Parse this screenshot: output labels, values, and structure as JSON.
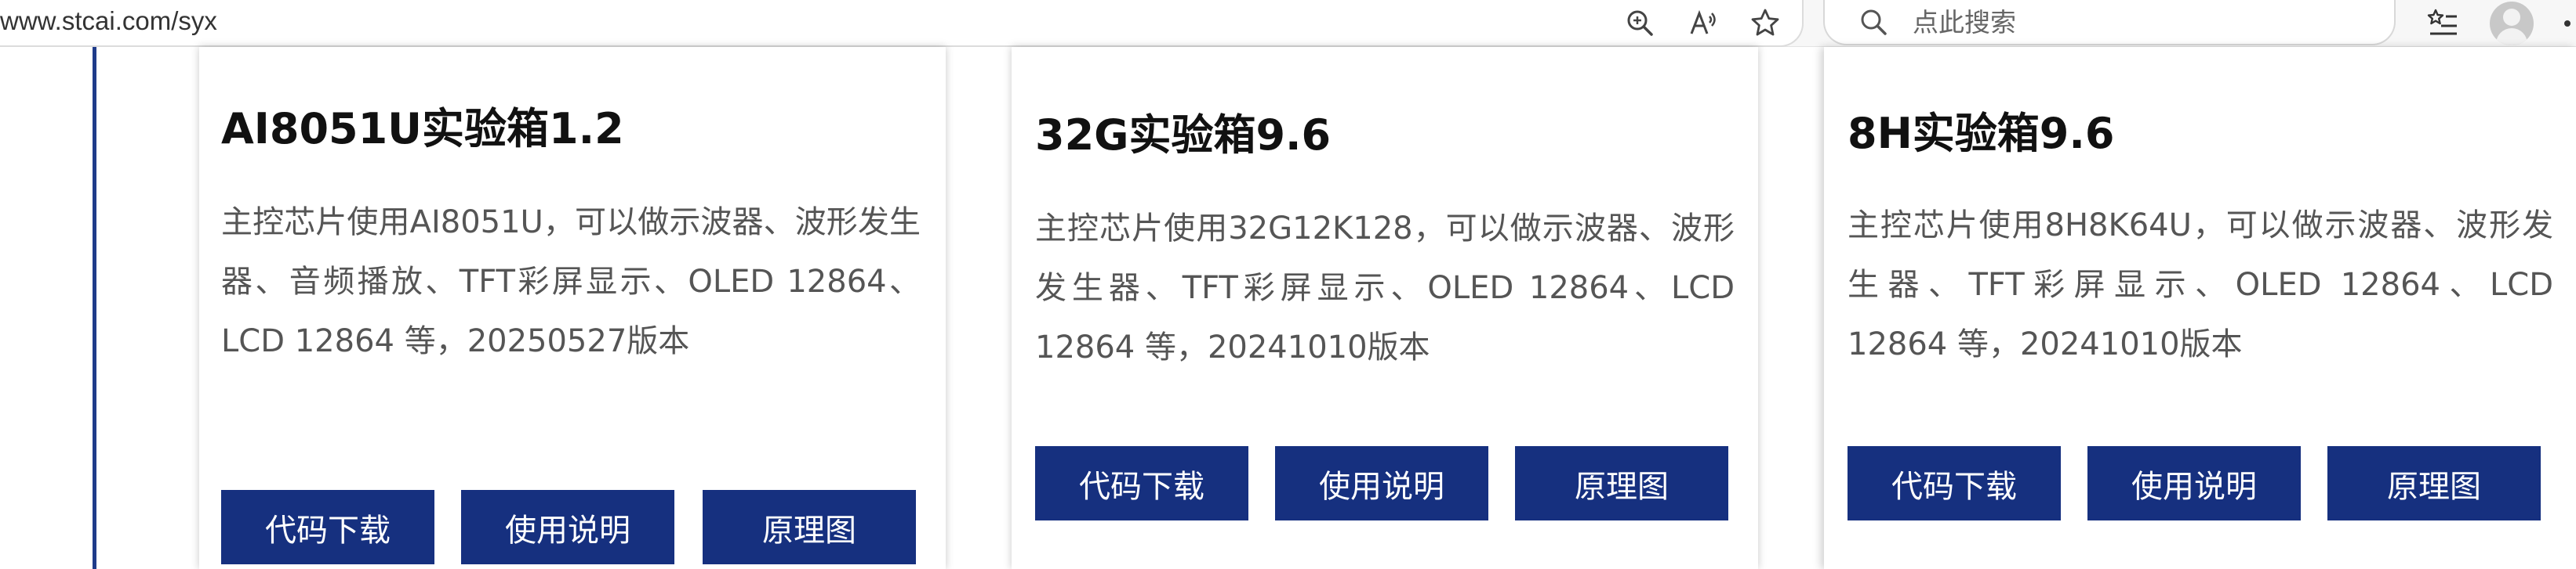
{
  "browser": {
    "url": "www.stcai.com/syx",
    "search_placeholder": "点此搜索",
    "icons": [
      "zoom-icon",
      "read-aloud-icon",
      "favorite-star-icon",
      "favorites-list-icon",
      "profile-avatar"
    ]
  },
  "colors": {
    "button_bg": "#16307f",
    "accent_rule": "#1f3b8a",
    "title": "#111111",
    "desc": "#555555"
  },
  "cards": [
    {
      "title": "AI8051U实验箱1.2",
      "description": "主控芯片使用AI8051U，可以做示波器、波形发生器、音频播放、TFT彩屏显示、OLED 12864、LCD 12864 等，20250527版本",
      "buttons": [
        "代码下载",
        "使用说明",
        "原理图"
      ]
    },
    {
      "title": "32G实验箱9.6",
      "description": "主控芯片使用32G12K128，可以做示波器、波形发生器、TFT彩屏显示、OLED 12864、LCD 12864 等，20241010版本",
      "buttons": [
        "代码下载",
        "使用说明",
        "原理图"
      ]
    },
    {
      "title": "8H实验箱9.6",
      "description": "主控芯片使用8H8K64U，可以做示波器、波形发生器、TFT彩屏显示、OLED 12864、LCD 12864 等，20241010版本",
      "buttons": [
        "代码下载",
        "使用说明",
        "原理图"
      ]
    }
  ]
}
